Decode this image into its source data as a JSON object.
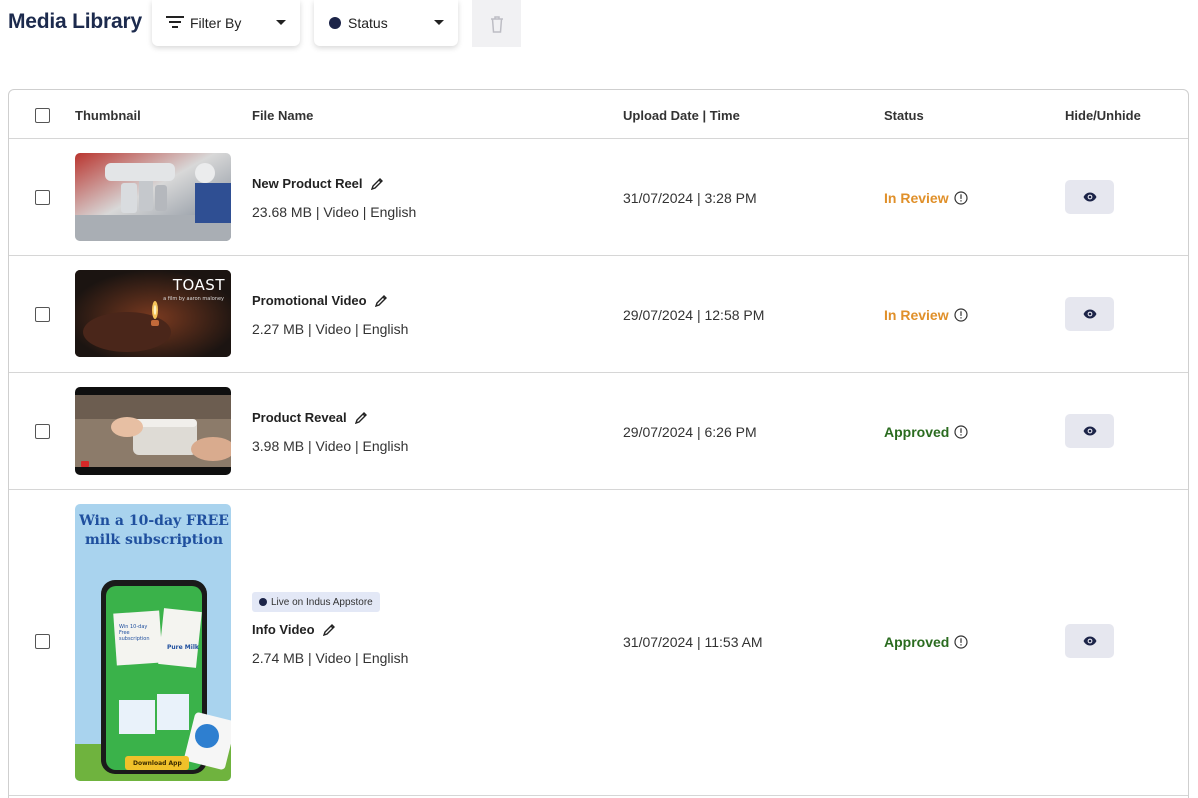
{
  "header": {
    "title": "Media Library",
    "filter_label": "Filter By",
    "status_label": "Status"
  },
  "table": {
    "columns": [
      "Thumbnail",
      "File Name",
      "Upload Date | Time",
      "Status",
      "Hide/Unhide"
    ],
    "rows": [
      {
        "name": "New Product Reel",
        "meta": "23.68 MB | Video | English",
        "date": "31/07/2024 | 3:28 PM",
        "status": "In Review",
        "thumb": "microscope"
      },
      {
        "name": "Promotional Video",
        "meta": "2.27 MB | Video | English",
        "date": "29/07/2024 | 12:58 PM",
        "status": "In Review",
        "thumb": "toast",
        "thumb_text": "TOAST",
        "thumb_subtext": "a film by aaron maloney"
      },
      {
        "name": "Product Reveal",
        "meta": "3.98 MB | Video | English",
        "date": "29/07/2024 | 6:26 PM",
        "status": "Approved",
        "thumb": "box"
      },
      {
        "name": "Info Video",
        "meta": "2.74 MB | Video | English",
        "date": "31/07/2024 | 11:53 AM",
        "status": "Approved",
        "thumb": "milk-ad",
        "badge": "Live on Indus Appstore",
        "thumb_headline": "Win a 10-day FREE milk subscription",
        "thumb_cta": "Download App",
        "thumb_card_text": "Win 10-day Free subscription",
        "thumb_brand": "Pure Milk"
      }
    ]
  },
  "colors": {
    "review": "#e0902a",
    "approved": "#2a6b1f",
    "title": "#1c2a4d",
    "eye_button": "#e6e7ef"
  },
  "icons": [
    "filter-icon",
    "status-dot-icon",
    "caret-down-icon",
    "trash-icon",
    "pencil-icon",
    "info-icon",
    "eye-icon"
  ]
}
